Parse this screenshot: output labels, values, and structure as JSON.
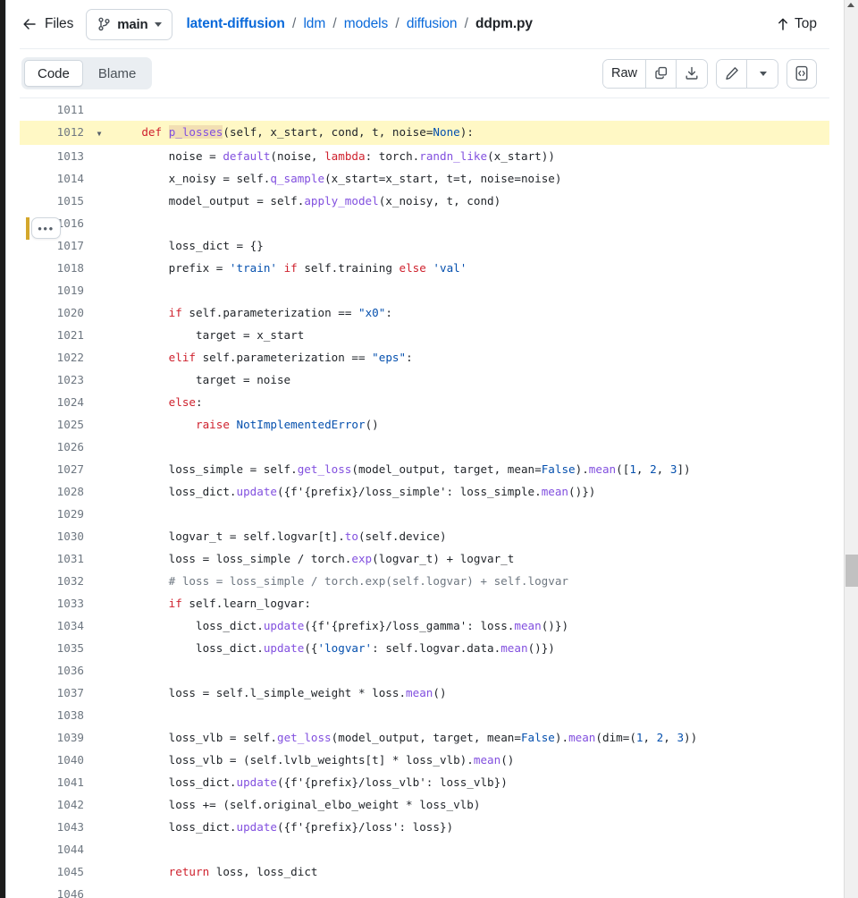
{
  "header": {
    "back_label": "Files",
    "back_icon": "arrow-left-icon",
    "branch": {
      "icon": "git-branch-icon",
      "name": "main",
      "caret_icon": "chevron-down-icon"
    },
    "breadcrumb": {
      "repo": "latent-diffusion",
      "segments": [
        "ldm",
        "models",
        "diffusion"
      ],
      "file": "ddpm.py",
      "separator": "/"
    },
    "top_link": {
      "label": "Top",
      "icon": "arrow-up-icon"
    }
  },
  "toolbar": {
    "tabs": [
      {
        "label": "Code",
        "active": true
      },
      {
        "label": "Blame",
        "active": false
      }
    ],
    "raw_label": "Raw",
    "copy_icon": "copy-icon",
    "download_icon": "download-icon",
    "edit_icon": "pencil-icon",
    "edit_caret_icon": "chevron-down-icon",
    "symbols_icon": "code-brackets-icon"
  },
  "code_view": {
    "highlighted_line": 1012,
    "kebab_label": "•••",
    "chevron": "⌄",
    "highlighted_symbol": "p_losses",
    "colors": {
      "keyword": "#cf222e",
      "function": "#8250df",
      "string": "#0a3069",
      "constant": "#0550ae",
      "comment": "#6e7781",
      "line_highlight": "#fff8c5",
      "symbol_highlight": "#f2dfb3",
      "gutter_text": "#6e7781",
      "marker": "#d4a72c"
    },
    "lines": [
      {
        "n": 1011,
        "text": ""
      },
      {
        "n": 1012,
        "text": "    def p_losses(self, x_start, cond, t, noise=None):"
      },
      {
        "n": 1013,
        "text": "        noise = default(noise, lambda: torch.randn_like(x_start))"
      },
      {
        "n": 1014,
        "text": "        x_noisy = self.q_sample(x_start=x_start, t=t, noise=noise)"
      },
      {
        "n": 1015,
        "text": "        model_output = self.apply_model(x_noisy, t, cond)"
      },
      {
        "n": 1016,
        "text": ""
      },
      {
        "n": 1017,
        "text": "        loss_dict = {}"
      },
      {
        "n": 1018,
        "text": "        prefix = 'train' if self.training else 'val'"
      },
      {
        "n": 1019,
        "text": ""
      },
      {
        "n": 1020,
        "text": "        if self.parameterization == \"x0\":"
      },
      {
        "n": 1021,
        "text": "            target = x_start"
      },
      {
        "n": 1022,
        "text": "        elif self.parameterization == \"eps\":"
      },
      {
        "n": 1023,
        "text": "            target = noise"
      },
      {
        "n": 1024,
        "text": "        else:"
      },
      {
        "n": 1025,
        "text": "            raise NotImplementedError()"
      },
      {
        "n": 1026,
        "text": ""
      },
      {
        "n": 1027,
        "text": "        loss_simple = self.get_loss(model_output, target, mean=False).mean([1, 2, 3])"
      },
      {
        "n": 1028,
        "text": "        loss_dict.update({f'{prefix}/loss_simple': loss_simple.mean()})"
      },
      {
        "n": 1029,
        "text": ""
      },
      {
        "n": 1030,
        "text": "        logvar_t = self.logvar[t].to(self.device)"
      },
      {
        "n": 1031,
        "text": "        loss = loss_simple / torch.exp(logvar_t) + logvar_t"
      },
      {
        "n": 1032,
        "text": "        # loss = loss_simple / torch.exp(self.logvar) + self.logvar"
      },
      {
        "n": 1033,
        "text": "        if self.learn_logvar:"
      },
      {
        "n": 1034,
        "text": "            loss_dict.update({f'{prefix}/loss_gamma': loss.mean()})"
      },
      {
        "n": 1035,
        "text": "            loss_dict.update({'logvar': self.logvar.data.mean()})"
      },
      {
        "n": 1036,
        "text": ""
      },
      {
        "n": 1037,
        "text": "        loss = self.l_simple_weight * loss.mean()"
      },
      {
        "n": 1038,
        "text": ""
      },
      {
        "n": 1039,
        "text": "        loss_vlb = self.get_loss(model_output, target, mean=False).mean(dim=(1, 2, 3))"
      },
      {
        "n": 1040,
        "text": "        loss_vlb = (self.lvlb_weights[t] * loss_vlb).mean()"
      },
      {
        "n": 1041,
        "text": "        loss_dict.update({f'{prefix}/loss_vlb': loss_vlb})"
      },
      {
        "n": 1042,
        "text": "        loss += (self.original_elbo_weight * loss_vlb)"
      },
      {
        "n": 1043,
        "text": "        loss_dict.update({f'{prefix}/loss': loss})"
      },
      {
        "n": 1044,
        "text": ""
      },
      {
        "n": 1045,
        "text": "        return loss, loss_dict"
      },
      {
        "n": 1046,
        "text": ""
      }
    ],
    "tokens": {
      "1012": [
        {
          "t": "    ",
          "c": ""
        },
        {
          "t": "def",
          "c": "kw"
        },
        {
          "t": " ",
          "c": ""
        },
        {
          "t": "p_losses",
          "c": "sym-hl"
        },
        {
          "t": "(self, x_start, cond, t, noise=",
          "c": ""
        },
        {
          "t": "None",
          "c": "cn"
        },
        {
          "t": "):",
          "c": ""
        }
      ],
      "1013": [
        {
          "t": "        noise = ",
          "c": ""
        },
        {
          "t": "default",
          "c": "fn"
        },
        {
          "t": "(noise, ",
          "c": ""
        },
        {
          "t": "lambda",
          "c": "kw"
        },
        {
          "t": ": torch.",
          "c": ""
        },
        {
          "t": "randn_like",
          "c": "fn"
        },
        {
          "t": "(x_start))",
          "c": ""
        }
      ],
      "1014": [
        {
          "t": "        x_noisy = self.",
          "c": ""
        },
        {
          "t": "q_sample",
          "c": "fn"
        },
        {
          "t": "(x_start=x_start, t=t, noise=noise)",
          "c": ""
        }
      ],
      "1015": [
        {
          "t": "        model_output = self.",
          "c": ""
        },
        {
          "t": "apply_model",
          "c": "fn"
        },
        {
          "t": "(x_noisy, t, cond)",
          "c": ""
        }
      ],
      "1017": [
        {
          "t": "        loss_dict = {}",
          "c": ""
        }
      ],
      "1018": [
        {
          "t": "        prefix = ",
          "c": ""
        },
        {
          "t": "'train'",
          "c": "stb"
        },
        {
          "t": " ",
          "c": ""
        },
        {
          "t": "if",
          "c": "kw"
        },
        {
          "t": " self.training ",
          "c": ""
        },
        {
          "t": "else",
          "c": "kw"
        },
        {
          "t": " ",
          "c": ""
        },
        {
          "t": "'val'",
          "c": "stb"
        }
      ],
      "1020": [
        {
          "t": "        ",
          "c": ""
        },
        {
          "t": "if",
          "c": "kw"
        },
        {
          "t": " self.parameterization == ",
          "c": ""
        },
        {
          "t": "\"x0\"",
          "c": "stb"
        },
        {
          "t": ":",
          "c": ""
        }
      ],
      "1021": [
        {
          "t": "            target = x_start",
          "c": ""
        }
      ],
      "1022": [
        {
          "t": "        ",
          "c": ""
        },
        {
          "t": "elif",
          "c": "kw"
        },
        {
          "t": " self.parameterization == ",
          "c": ""
        },
        {
          "t": "\"eps\"",
          "c": "stb"
        },
        {
          "t": ":",
          "c": ""
        }
      ],
      "1023": [
        {
          "t": "            target = noise",
          "c": ""
        }
      ],
      "1024": [
        {
          "t": "        ",
          "c": ""
        },
        {
          "t": "else",
          "c": "kw"
        },
        {
          "t": ":",
          "c": ""
        }
      ],
      "1025": [
        {
          "t": "            ",
          "c": ""
        },
        {
          "t": "raise",
          "c": "kw"
        },
        {
          "t": " ",
          "c": ""
        },
        {
          "t": "NotImplementedError",
          "c": "cn"
        },
        {
          "t": "()",
          "c": ""
        }
      ],
      "1027": [
        {
          "t": "        loss_simple = self.",
          "c": ""
        },
        {
          "t": "get_loss",
          "c": "fn"
        },
        {
          "t": "(model_output, target, mean=",
          "c": ""
        },
        {
          "t": "False",
          "c": "cn"
        },
        {
          "t": ").",
          "c": ""
        },
        {
          "t": "mean",
          "c": "fn"
        },
        {
          "t": "([",
          "c": ""
        },
        {
          "t": "1",
          "c": "cn"
        },
        {
          "t": ", ",
          "c": ""
        },
        {
          "t": "2",
          "c": "cn"
        },
        {
          "t": ", ",
          "c": ""
        },
        {
          "t": "3",
          "c": "cn"
        },
        {
          "t": "])",
          "c": ""
        }
      ],
      "1028": [
        {
          "t": "        loss_dict.",
          "c": ""
        },
        {
          "t": "update",
          "c": "fn"
        },
        {
          "t": "({f'{prefix}/loss_simple': loss_simple.",
          "c": ""
        },
        {
          "t": "mean",
          "c": "fn"
        },
        {
          "t": "()})",
          "c": ""
        }
      ],
      "1030": [
        {
          "t": "        logvar_t = self.logvar[t].",
          "c": ""
        },
        {
          "t": "to",
          "c": "fn"
        },
        {
          "t": "(self.device)",
          "c": ""
        }
      ],
      "1031": [
        {
          "t": "        loss = loss_simple / torch.",
          "c": ""
        },
        {
          "t": "exp",
          "c": "fn"
        },
        {
          "t": "(logvar_t) + logvar_t",
          "c": ""
        }
      ],
      "1032": [
        {
          "t": "        # loss = loss_simple / torch.exp(self.logvar) + self.logvar",
          "c": "cm"
        }
      ],
      "1033": [
        {
          "t": "        ",
          "c": ""
        },
        {
          "t": "if",
          "c": "kw"
        },
        {
          "t": " self.learn_logvar:",
          "c": ""
        }
      ],
      "1034": [
        {
          "t": "            loss_dict.",
          "c": ""
        },
        {
          "t": "update",
          "c": "fn"
        },
        {
          "t": "({f'{prefix}/loss_gamma': loss.",
          "c": ""
        },
        {
          "t": "mean",
          "c": "fn"
        },
        {
          "t": "()})",
          "c": ""
        }
      ],
      "1035": [
        {
          "t": "            loss_dict.",
          "c": ""
        },
        {
          "t": "update",
          "c": "fn"
        },
        {
          "t": "({",
          "c": ""
        },
        {
          "t": "'logvar'",
          "c": "stb"
        },
        {
          "t": ": self.logvar.data.",
          "c": ""
        },
        {
          "t": "mean",
          "c": "fn"
        },
        {
          "t": "()})",
          "c": ""
        }
      ],
      "1037": [
        {
          "t": "        loss = self.l_simple_weight * loss.",
          "c": ""
        },
        {
          "t": "mean",
          "c": "fn"
        },
        {
          "t": "()",
          "c": ""
        }
      ],
      "1039": [
        {
          "t": "        loss_vlb = self.",
          "c": ""
        },
        {
          "t": "get_loss",
          "c": "fn"
        },
        {
          "t": "(model_output, target, mean=",
          "c": ""
        },
        {
          "t": "False",
          "c": "cn"
        },
        {
          "t": ").",
          "c": ""
        },
        {
          "t": "mean",
          "c": "fn"
        },
        {
          "t": "(dim=(",
          "c": ""
        },
        {
          "t": "1",
          "c": "cn"
        },
        {
          "t": ", ",
          "c": ""
        },
        {
          "t": "2",
          "c": "cn"
        },
        {
          "t": ", ",
          "c": ""
        },
        {
          "t": "3",
          "c": "cn"
        },
        {
          "t": "))",
          "c": ""
        }
      ],
      "1040": [
        {
          "t": "        loss_vlb = (self.lvlb_weights[t] * loss_vlb).",
          "c": ""
        },
        {
          "t": "mean",
          "c": "fn"
        },
        {
          "t": "()",
          "c": ""
        }
      ],
      "1041": [
        {
          "t": "        loss_dict.",
          "c": ""
        },
        {
          "t": "update",
          "c": "fn"
        },
        {
          "t": "({f'{prefix}/loss_vlb': loss_vlb})",
          "c": ""
        }
      ],
      "1042": [
        {
          "t": "        loss += (self.original_elbo_weight * loss_vlb)",
          "c": ""
        }
      ],
      "1043": [
        {
          "t": "        loss_dict.",
          "c": ""
        },
        {
          "t": "update",
          "c": "fn"
        },
        {
          "t": "({f'{prefix}/loss': loss})",
          "c": ""
        }
      ],
      "1045": [
        {
          "t": "        ",
          "c": ""
        },
        {
          "t": "return",
          "c": "kw"
        },
        {
          "t": " loss, loss_dict",
          "c": ""
        }
      ]
    }
  },
  "scrollbar": {
    "up_arrow_icon": "triangle-up-icon",
    "thumb": "scroll-thumb"
  }
}
